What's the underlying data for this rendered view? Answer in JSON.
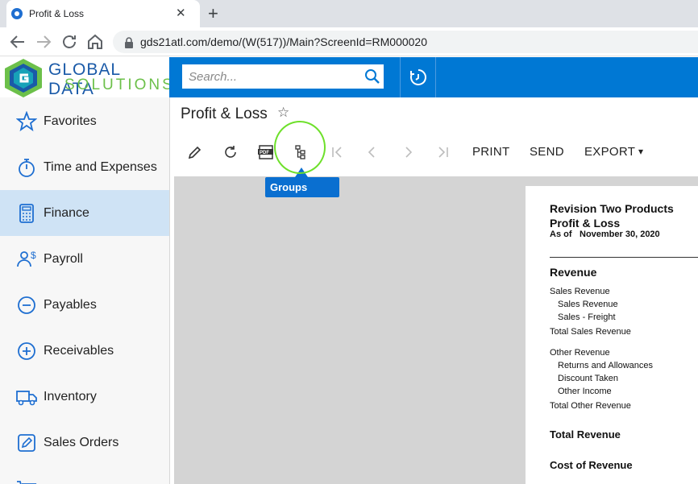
{
  "browser": {
    "tab_title": "Profit & Loss",
    "close_glyph": "✕",
    "newtab_glyph": "+",
    "url": "gds21atl.com/demo/(W(517))/Main?ScreenId=RM000020"
  },
  "logo": {
    "line1": "GLOBAL DATA",
    "line2": "SOLUTIONS",
    "colors": {
      "green": "#6cc04a",
      "blue": "#1a5aa8",
      "teal": "#17a2b8"
    }
  },
  "topbar": {
    "search_placeholder": "Search...",
    "accent": "#0078d4"
  },
  "sidebar": {
    "items": [
      {
        "label": "Favorites",
        "icon": "star-icon"
      },
      {
        "label": "Time and Expenses",
        "icon": "stopwatch-icon"
      },
      {
        "label": "Finance",
        "icon": "calculator-icon",
        "active": true
      },
      {
        "label": "Payroll",
        "icon": "payroll-icon"
      },
      {
        "label": "Payables",
        "icon": "minus-circle-icon"
      },
      {
        "label": "Receivables",
        "icon": "plus-circle-icon"
      },
      {
        "label": "Inventory",
        "icon": "truck-icon"
      },
      {
        "label": "Sales Orders",
        "icon": "pencil-square-icon"
      },
      {
        "label": "",
        "icon": "cart-icon"
      }
    ]
  },
  "page": {
    "title": "Profit & Loss",
    "star_glyph": "☆"
  },
  "toolbar": {
    "print": "PRINT",
    "send": "SEND",
    "export": "EXPORT",
    "export_caret": "▾",
    "tooltip": "Groups"
  },
  "report": {
    "company": "Revision Two Products",
    "title": "Profit & Loss",
    "asof_label": "As of",
    "asof_date": "November 30, 2020",
    "revenue_heading": "Revenue",
    "sales_revenue": "Sales Revenue",
    "sales_revenue_sub": "Sales Revenue",
    "sales_freight": "Sales - Freight",
    "total_sales_revenue": "Total Sales Revenue",
    "other_revenue": "Other Revenue",
    "returns": "Returns and Allowances",
    "discount": "Discount Taken",
    "other_income": "Other Income",
    "total_other_revenue": "Total Other Revenue",
    "total_revenue": "Total Revenue",
    "cost_of_revenue": "Cost of Revenue"
  }
}
